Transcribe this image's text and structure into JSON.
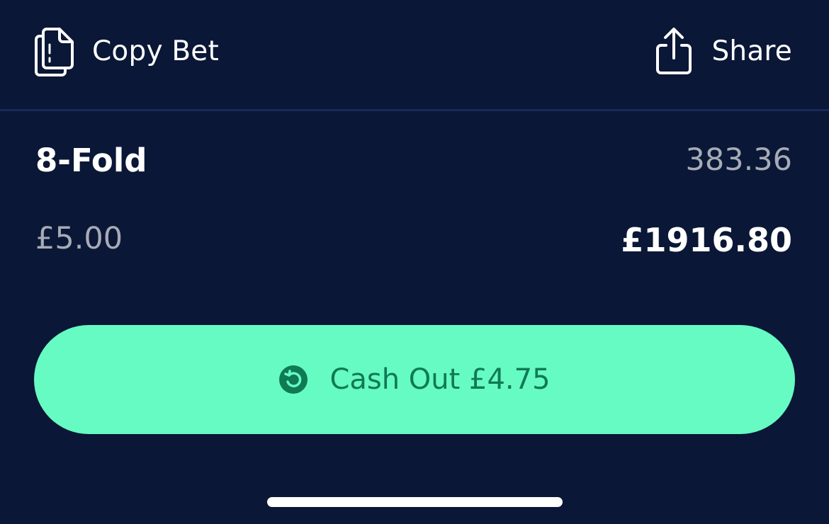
{
  "header": {
    "copy_label": "Copy Bet",
    "share_label": "Share",
    "copy_icon": "copy-icon",
    "share_icon": "share-icon"
  },
  "bet": {
    "type": "8-Fold",
    "odds": "383.36",
    "stake": "£5.00",
    "potential_returns": "£1916.80"
  },
  "cashout": {
    "label": "Cash Out £4.75",
    "icon": "cashout-icon"
  },
  "colors": {
    "background": "#0a1736",
    "accent": "#66fbc2",
    "accent_text": "#0f7a54",
    "muted_text": "#a7abb6"
  }
}
